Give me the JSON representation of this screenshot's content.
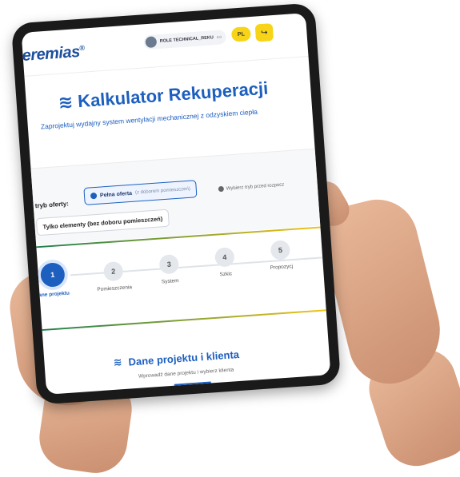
{
  "app": {
    "logo": "jeremias",
    "logo_mark": "®",
    "user_name": "ROLE TECHNICAL_REKU",
    "user_extra": "ea",
    "lang": "PL",
    "logout_icon": "logout-icon"
  },
  "header": {
    "title": "Kalkulator Rekuperacji",
    "subtitle": "Zaprojektuj wydajny system wentylacji mechanicznej z odzyskiem ciepła",
    "title_icon": "wind-icon"
  },
  "offer": {
    "label": "tryb oferty:",
    "full_label": "Pełna oferta",
    "full_note": "(z doborem pomieszczeń)",
    "hint": "Wybierz tryb przed rozpocz",
    "elements_label": "Tylko elementy (bez doboru pomieszczeń)"
  },
  "stepper": {
    "steps": [
      {
        "number": "1",
        "label": "ane projektu"
      },
      {
        "number": "2",
        "label": "Pomieszczenia"
      },
      {
        "number": "3",
        "label": "System"
      },
      {
        "number": "4",
        "label": "Szkic"
      },
      {
        "number": "5",
        "label": "Propozycj"
      }
    ],
    "active_index": 0
  },
  "section": {
    "title": "Dane projektu i klienta",
    "subtitle": "Wprowadź dane projektu i wybierz klienta"
  },
  "colors": {
    "accent": "#1d5fbf",
    "yellow": "#f7d417",
    "bezel": "#1a1a1a"
  }
}
